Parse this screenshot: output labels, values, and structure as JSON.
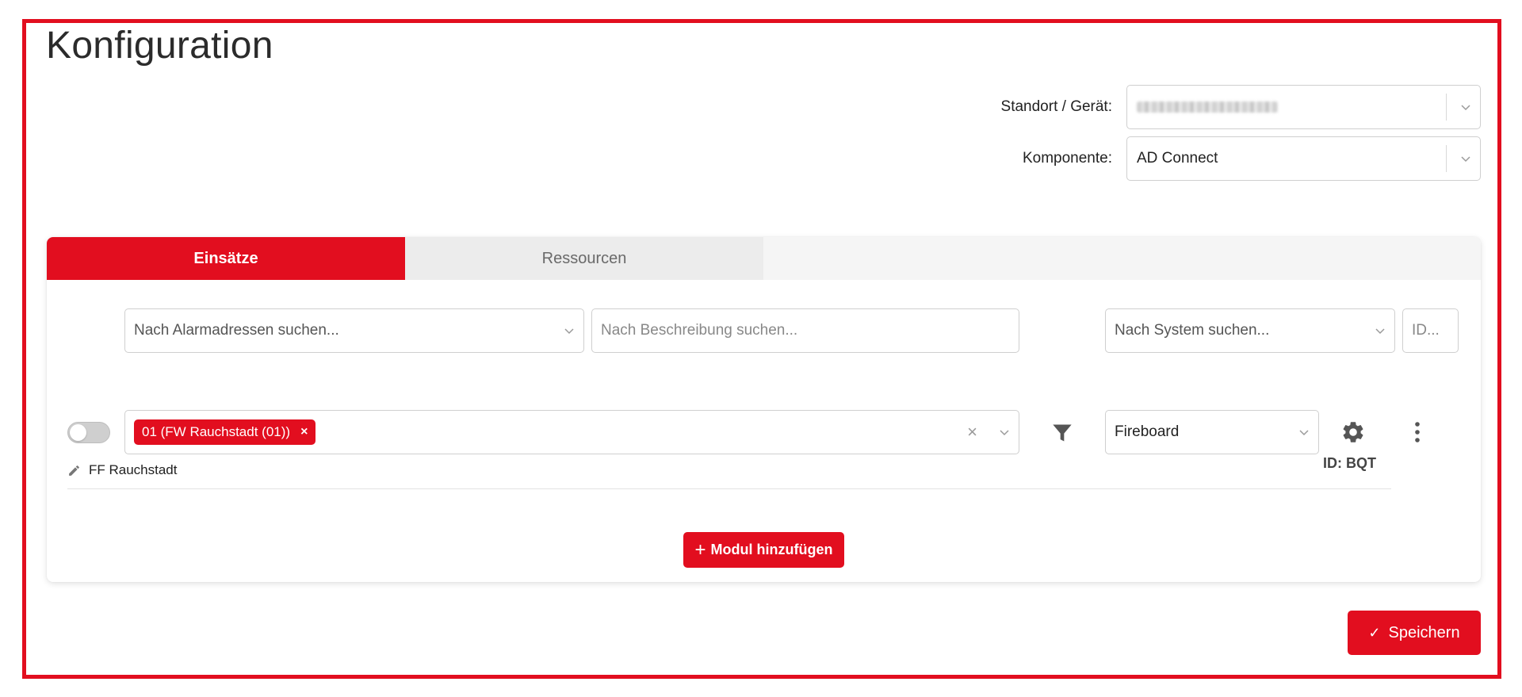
{
  "page": {
    "title": "Konfiguration"
  },
  "colors": {
    "accent": "#e20e1f",
    "tab_inactive_bg": "#ececec",
    "border": "#cfcfcf"
  },
  "form": {
    "standort_label": "Standort / Gerät:",
    "standort_value": "",
    "komponente_label": "Komponente:",
    "komponente_value": "AD Connect"
  },
  "tabs": [
    {
      "label": "Einsätze",
      "active": true
    },
    {
      "label": "Ressourcen",
      "active": false
    }
  ],
  "filters": {
    "alarm_placeholder": "Nach Alarmadressen suchen...",
    "description_placeholder": "Nach Beschreibung suchen...",
    "system_placeholder": "Nach System suchen...",
    "id_placeholder": "ID..."
  },
  "module": {
    "enabled": false,
    "tag_label": "01 (FW Rauchstadt (01))",
    "tag_remove": "×",
    "clear": "×",
    "system_value": "Fireboard",
    "id_label": "ID: BQT",
    "description": "FF Rauchstadt"
  },
  "buttons": {
    "add_module": "Modul hinzufügen",
    "add_icon": "+",
    "save": "Speichern",
    "save_icon": "✓"
  },
  "icons": [
    "pencil-icon",
    "filter-icon",
    "gear-icon",
    "kebab-menu-icon",
    "chevron-down-icon",
    "check-icon",
    "plus-icon"
  ]
}
